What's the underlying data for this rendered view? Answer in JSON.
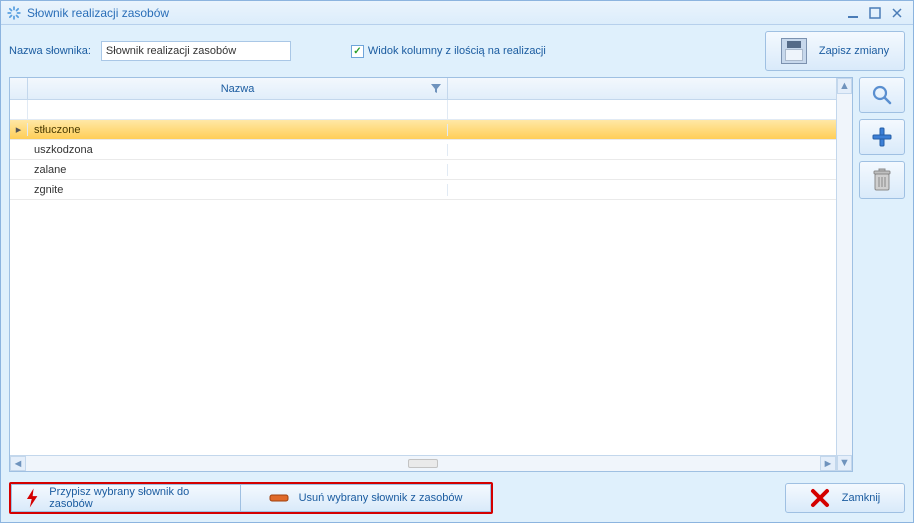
{
  "window": {
    "title": "Słownik realizacji zasobów"
  },
  "header": {
    "name_label": "Nazwa słownika:",
    "name_value": "Słownik realizacji zasobów",
    "qty_checkbox_label": "Widok kolumny z ilością na realizacji",
    "qty_checkbox_checked": true,
    "save_label": "Zapisz zmiany"
  },
  "grid": {
    "columns": {
      "name": "Nazwa"
    },
    "rows": [
      {
        "name": "stłuczone",
        "selected": true
      },
      {
        "name": "uszkodzona",
        "selected": false
      },
      {
        "name": "zalane",
        "selected": false
      },
      {
        "name": "zgnite",
        "selected": false
      }
    ]
  },
  "sideIcons": {
    "search": "search-icon",
    "add": "plus-icon",
    "delete": "trash-icon"
  },
  "footer": {
    "assign_label": "Przypisz wybrany słownik do zasobów",
    "remove_label": "Usuń wybrany słownik z zasobów",
    "close_label": "Zamknij"
  }
}
